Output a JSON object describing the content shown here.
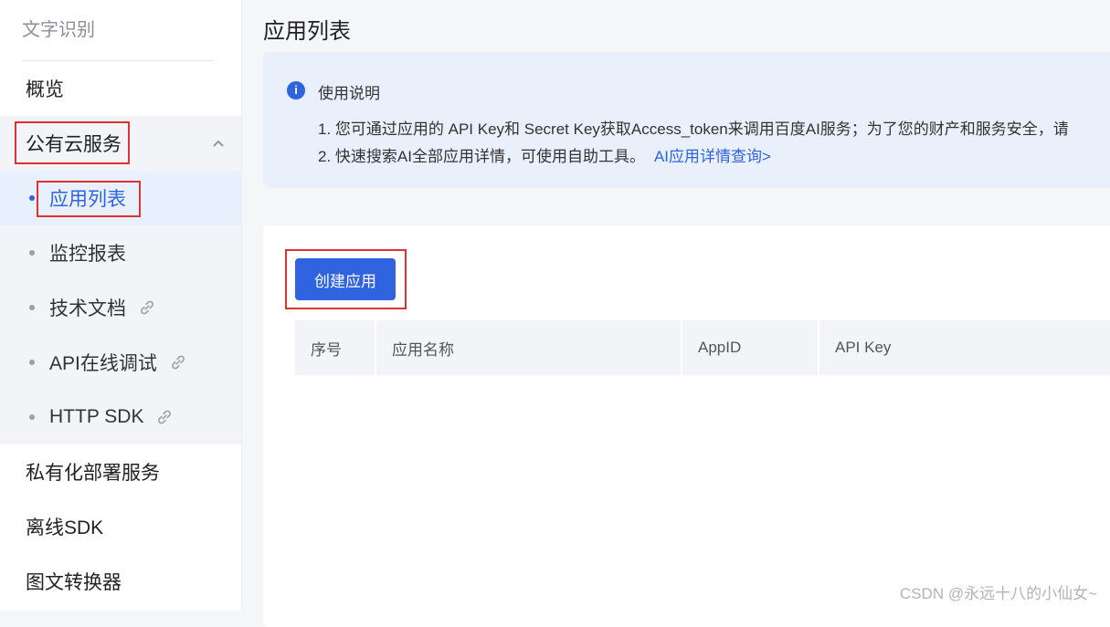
{
  "sidebar": {
    "title": "文字识别",
    "items": [
      {
        "label": "概览"
      },
      {
        "label": "公有云服务"
      },
      {
        "label": "私有化部署服务"
      },
      {
        "label": "离线SDK"
      },
      {
        "label": "图文转换器"
      }
    ],
    "sub_items": [
      {
        "label": "应用列表"
      },
      {
        "label": "监控报表"
      },
      {
        "label": "技术文档"
      },
      {
        "label": "API在线调试"
      },
      {
        "label": "HTTP SDK"
      }
    ]
  },
  "main": {
    "title": "应用列表",
    "notice": {
      "title": "使用说明",
      "line1": "1. 您可通过应用的 API Key和 Secret Key获取Access_token来调用百度AI服务；为了您的财产和服务安全，请",
      "line2": "2. 快速搜索AI全部应用详情，可使用自助工具。",
      "link": "AI应用详情查询>"
    },
    "create_button": "创建应用",
    "table": {
      "columns": [
        "序号",
        "应用名称",
        "AppID",
        "API Key"
      ]
    }
  },
  "watermark": "CSDN @永远十八的小仙女~",
  "colors": {
    "accent": "#2f63e0",
    "highlight_box": "#e03131"
  }
}
